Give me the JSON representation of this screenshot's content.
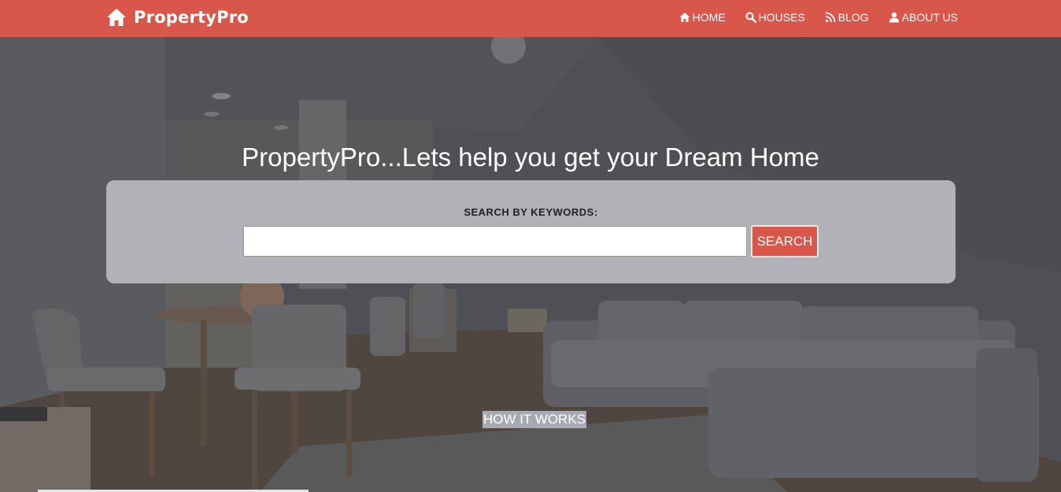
{
  "brand": {
    "name": "PropertyPro",
    "icon": "home-icon"
  },
  "nav": {
    "items": [
      {
        "label": "HOME",
        "icon": "home-icon"
      },
      {
        "label": "HOUSES",
        "icon": "search-icon"
      },
      {
        "label": "BLOG",
        "icon": "rss-icon"
      },
      {
        "label": "ABOUT US",
        "icon": "user-icon"
      }
    ]
  },
  "hero": {
    "title": "PropertyPro...Lets help you get your Dream Home",
    "search": {
      "label": "SEARCH BY KEYWORDS:",
      "value": "",
      "placeholder": "",
      "button": "SEARCH"
    },
    "how_it_works": "HOW IT WORKS"
  },
  "colors": {
    "navbar": "#d9574a",
    "search_panel": "#b0b2b8",
    "button": "#d9574a"
  }
}
